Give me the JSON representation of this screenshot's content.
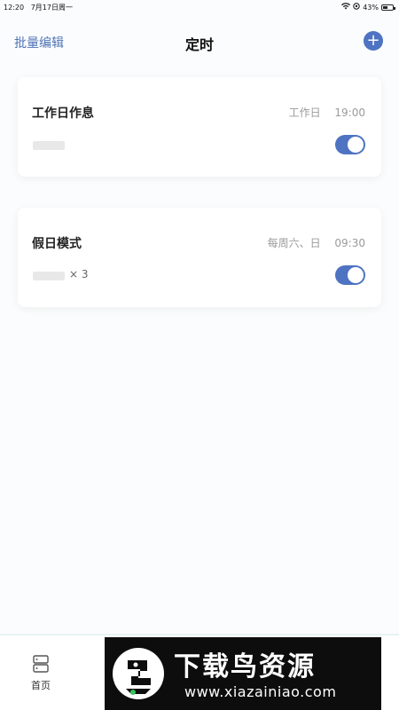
{
  "status_bar": {
    "time": "12:20",
    "date": "7月17日周一",
    "battery": "43%"
  },
  "header": {
    "batch_edit": "批量编辑",
    "title": "定时",
    "add_label": "+"
  },
  "schedules": [
    {
      "name": "工作日作息",
      "days": "工作日",
      "time": "19:00",
      "repeat": "",
      "enabled": true
    },
    {
      "name": "假日模式",
      "days": "每周六、日",
      "time": "09:30",
      "repeat": "× 3",
      "enabled": true
    }
  ],
  "tab_bar": {
    "home_label": "首页"
  },
  "watermark": {
    "title": "下载鸟资源",
    "url": "www.xiazainiao.com"
  },
  "colors": {
    "accent": "#4e73c2",
    "link": "#4e73b6"
  }
}
